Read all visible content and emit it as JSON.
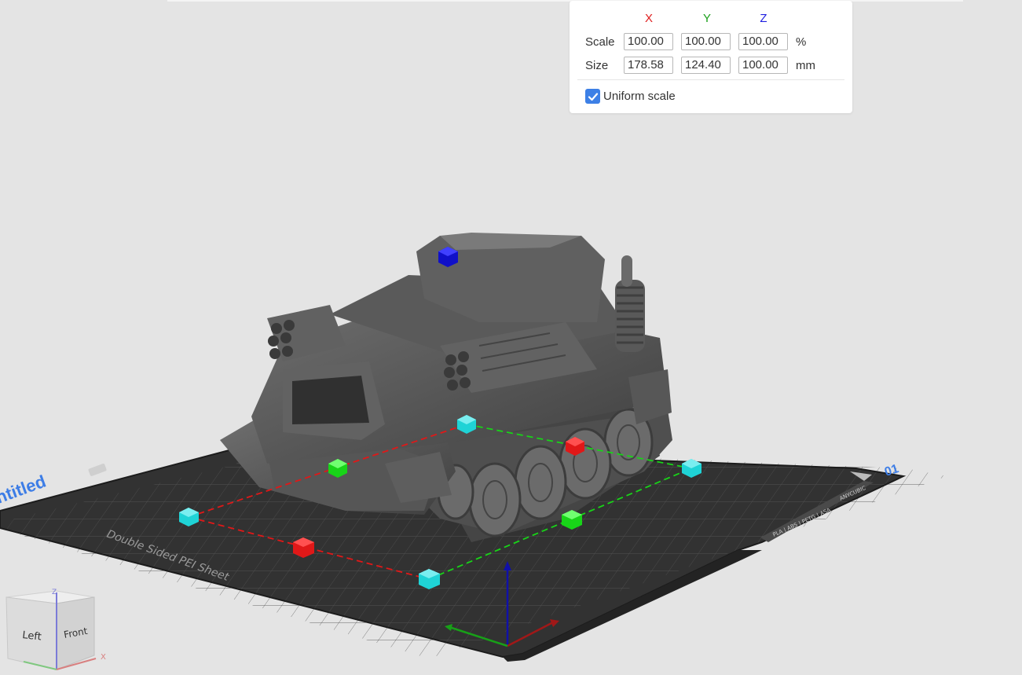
{
  "scale_panel": {
    "headers": {
      "x": "X",
      "y": "Y",
      "z": "Z"
    },
    "axis_colors": {
      "x": "#e02020",
      "y": "#1aa01a",
      "z": "#2020e0"
    },
    "rows": {
      "scale": {
        "label": "Scale",
        "x": "100.00",
        "y": "100.00",
        "z": "100.00",
        "unit": "%"
      },
      "size": {
        "label": "Size",
        "x": "178.58",
        "y": "124.40",
        "z": "100.00",
        "unit": "mm"
      }
    },
    "uniform_scale": {
      "label": "Uniform scale",
      "checked": true
    }
  },
  "bed": {
    "label": "Double Sided PEI Sheet",
    "plate_name": "ntitled",
    "plate_number": "01",
    "tag_left": "PLA | ABS | PETG | ASA",
    "tag_right": "ANYCUBIC"
  },
  "navcube": {
    "left": "Left",
    "front": "Front",
    "axis_z": "Z",
    "axis_x": "X"
  },
  "colors": {
    "background": "#e4e4e4",
    "bed": "#3a3a3a",
    "model": "#5b5b5b",
    "handle_cyan": "#1fd3d6",
    "handle_red": "#e01818",
    "handle_green": "#18d418",
    "handle_blue": "#1010c8",
    "accent": "#3d80e6"
  }
}
